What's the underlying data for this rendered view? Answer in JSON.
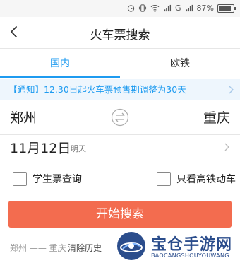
{
  "status_bar": {
    "battery_text": "87%",
    "battery_level": 0.87,
    "icons": [
      "alarm-icon",
      "vibrate-icon",
      "wifi-icon",
      "signal-icon",
      "g-network-icon",
      "battery-icon"
    ],
    "network_label": "G"
  },
  "header": {
    "title": "火车票搜索",
    "back_icon": "back-arrow-icon"
  },
  "tabs": [
    {
      "label": "国内",
      "active": true
    },
    {
      "label": "欧铁",
      "active": false
    }
  ],
  "notice": {
    "text": "【通知】12.30日起火车票预售期调整为30天"
  },
  "route": {
    "from": "郑州",
    "to": "重庆",
    "swap_icon": "swap-icon"
  },
  "date": {
    "day": "11月12日",
    "relative": "明天"
  },
  "options": {
    "student_label": "学生票查询",
    "student_checked": false,
    "gaotie_label": "只看高铁动车",
    "gaotie_checked": false
  },
  "search_button": {
    "label": "开始搜索"
  },
  "history": {
    "item": "郑州 —— 重庆",
    "clear_label": "清除历史"
  },
  "watermark": {
    "text_cn": "宝仓手游网",
    "text_en": "BAOCANGSHOUYOUWANG"
  },
  "colors": {
    "accent": "#1e9bf0",
    "button": "#f36c4f",
    "notice_bg": "#eef6fd",
    "watermark": "#2b4d8c"
  }
}
